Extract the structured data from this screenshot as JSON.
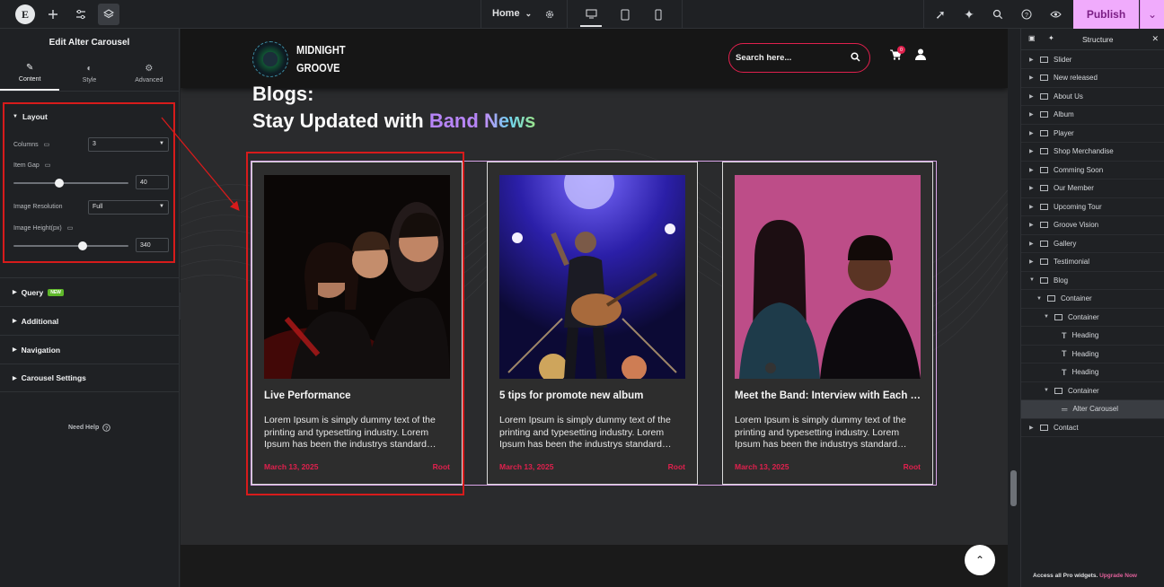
{
  "topbar": {
    "page_selector": "Home",
    "publish_label": "Publish"
  },
  "left_panel": {
    "title": "Edit Alter Carousel",
    "tabs": [
      {
        "label": "Content",
        "icon": "pencil-icon"
      },
      {
        "label": "Style",
        "icon": "half-circle-icon"
      },
      {
        "label": "Advanced",
        "icon": "gear-icon"
      }
    ],
    "layout": {
      "heading": "Layout",
      "columns_label": "Columns",
      "columns_value": "3",
      "item_gap_label": "Item Gap",
      "item_gap_value": "40",
      "item_gap_level": 0.4,
      "image_resolution_label": "Image Resolution",
      "image_resolution_value": "Full",
      "image_height_label": "Image Height(px)",
      "image_height_value": "340",
      "image_height_level": 0.6
    },
    "sections": [
      {
        "label": "Query",
        "badge": "NEW"
      },
      {
        "label": "Additional"
      },
      {
        "label": "Navigation"
      },
      {
        "label": "Carousel Settings"
      }
    ],
    "need_help": "Need Help"
  },
  "site": {
    "brand_line1": "MIDNIGHT",
    "brand_line2": "GROOVE",
    "search_placeholder": "Search here...",
    "cart_count": "0",
    "blog_heading_line1": "Blogs:",
    "blog_heading_prefix": "Stay Updated with",
    "blog_heading_band": "Band",
    "blog_heading_news": "News"
  },
  "cards": [
    {
      "title": "Live Performance",
      "excerpt": "Lorem Ipsum is simply dummy text of the printing and typesetting industry. Lorem Ipsum has been the industrys standard dummy text.",
      "date": "March 13, 2025",
      "author": "Root"
    },
    {
      "title": "5 tips for promote new album",
      "excerpt": "Lorem Ipsum is simply dummy text of the printing and typesetting industry. Lorem Ipsum has been the industrys standard dummy text.",
      "date": "March 13, 2025",
      "author": "Root"
    },
    {
      "title": "Meet the Band: Interview with Each Member",
      "excerpt": "Lorem Ipsum is simply dummy text of the printing and typesetting industry. Lorem Ipsum has been the industrys standard dummy text.",
      "date": "March 13, 2025",
      "author": "Root"
    }
  ],
  "structure": {
    "title": "Structure",
    "items": [
      {
        "label": "Slider",
        "depth": 0,
        "type": "container",
        "toggle": "right"
      },
      {
        "label": "New released",
        "depth": 0,
        "type": "container",
        "toggle": "right"
      },
      {
        "label": "About Us",
        "depth": 0,
        "type": "container",
        "toggle": "right"
      },
      {
        "label": "Album",
        "depth": 0,
        "type": "container",
        "toggle": "right"
      },
      {
        "label": "Player",
        "depth": 0,
        "type": "container",
        "toggle": "right"
      },
      {
        "label": "Shop Merchandise",
        "depth": 0,
        "type": "container",
        "toggle": "right"
      },
      {
        "label": "Comming Soon",
        "depth": 0,
        "type": "container",
        "toggle": "right"
      },
      {
        "label": "Our Member",
        "depth": 0,
        "type": "container",
        "toggle": "right"
      },
      {
        "label": "Upcoming Tour",
        "depth": 0,
        "type": "container",
        "toggle": "right"
      },
      {
        "label": "Groove Vision",
        "depth": 0,
        "type": "container",
        "toggle": "right"
      },
      {
        "label": "Gallery",
        "depth": 0,
        "type": "container",
        "toggle": "right"
      },
      {
        "label": "Testimonial",
        "depth": 0,
        "type": "container",
        "toggle": "right"
      },
      {
        "label": "Blog",
        "depth": 0,
        "type": "container",
        "toggle": "down"
      },
      {
        "label": "Container",
        "depth": 1,
        "type": "container",
        "toggle": "down"
      },
      {
        "label": "Container",
        "depth": 2,
        "type": "container",
        "toggle": "down"
      },
      {
        "label": "Heading",
        "depth": 3,
        "type": "heading",
        "toggle": ""
      },
      {
        "label": "Heading",
        "depth": 3,
        "type": "heading",
        "toggle": ""
      },
      {
        "label": "Heading",
        "depth": 3,
        "type": "heading",
        "toggle": ""
      },
      {
        "label": "Container",
        "depth": 2,
        "type": "container",
        "toggle": "down"
      },
      {
        "label": "Alter Carousel",
        "depth": 3,
        "type": "widget",
        "toggle": "",
        "selected": true
      },
      {
        "label": "Contact",
        "depth": 0,
        "type": "container",
        "toggle": "right"
      }
    ],
    "pro_note": "Access all Pro widgets.",
    "upgrade_link": "Upgrade Now"
  },
  "colors": {
    "accent_red": "#e0204d",
    "publish_bg": "#f0abfc",
    "highlight_red": "#d71b1b"
  }
}
